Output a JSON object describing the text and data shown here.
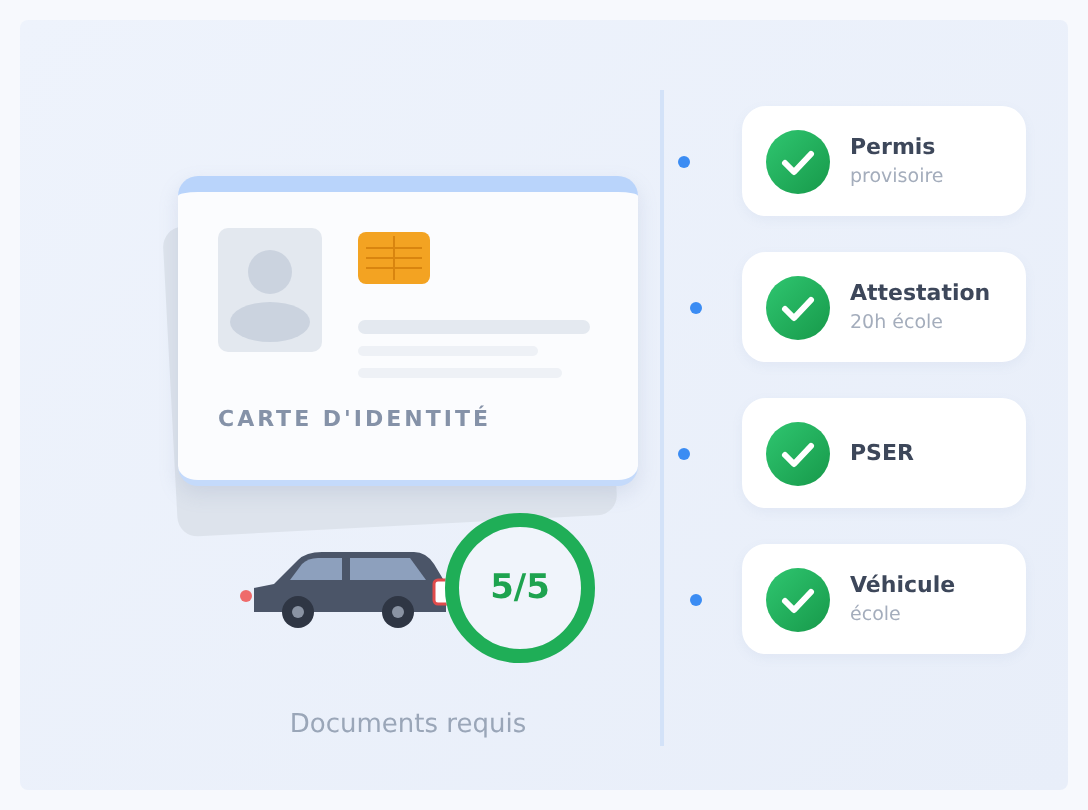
{
  "id_card": {
    "label": "CARTE D'IDENTITÉ"
  },
  "progress": {
    "reading": "5/5",
    "level": 1
  },
  "caption": "Documents requis",
  "documents": [
    {
      "title": "Permis",
      "subtitle": "provisoire",
      "done": true
    },
    {
      "title": "Attestation",
      "subtitle": "20h école",
      "done": true
    },
    {
      "title": "PSER",
      "done": true
    },
    {
      "title": "Véhicule",
      "subtitle": "école",
      "done": true
    }
  ]
}
